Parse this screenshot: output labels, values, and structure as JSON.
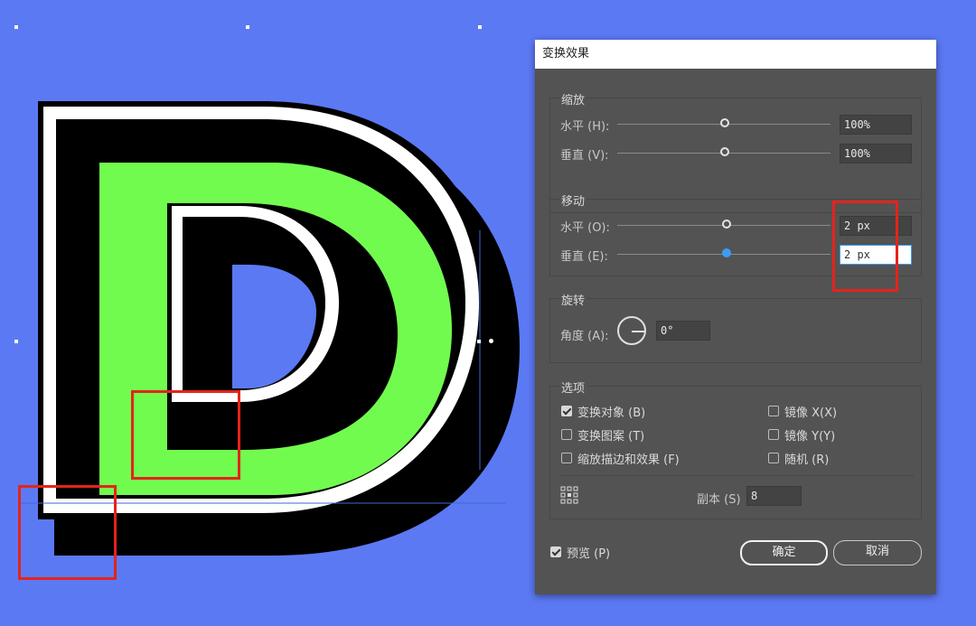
{
  "dialog": {
    "title": "变换效果",
    "scale": {
      "title": "缩放",
      "horizontal_label": "水平 (H):",
      "horizontal_value": "100%",
      "vertical_label": "垂直 (V):",
      "vertical_value": "100%"
    },
    "move": {
      "title": "移动",
      "horizontal_label": "水平 (O):",
      "horizontal_value": "2 px",
      "vertical_label": "垂直 (E):",
      "vertical_value": "2 px"
    },
    "rotate": {
      "title": "旋转",
      "angle_label": "角度 (A):",
      "angle_value": "0°"
    },
    "options": {
      "title": "选项",
      "transform_objects": {
        "label": "变换对象 (B)",
        "checked": true
      },
      "transform_patterns": {
        "label": "变换图案 (T)",
        "checked": false
      },
      "scale_strokes": {
        "label": "缩放描边和效果 (F)",
        "checked": false
      },
      "reflect_x": {
        "label": "镜像 X(X)",
        "checked": false
      },
      "reflect_y": {
        "label": "镜像 Y(Y)",
        "checked": false
      },
      "random": {
        "label": "随机 (R)",
        "checked": false
      },
      "copies_label": "副本 (S)",
      "copies_value": "8"
    },
    "preview": {
      "label": "预览 (P)",
      "checked": true
    },
    "ok_label": "确定",
    "cancel_label": "取消"
  },
  "colors": {
    "background": "#5c79f4",
    "letter_fill": "#72fb4f",
    "highlight": "#e3241b",
    "active_slider": "#3d9bf5"
  }
}
